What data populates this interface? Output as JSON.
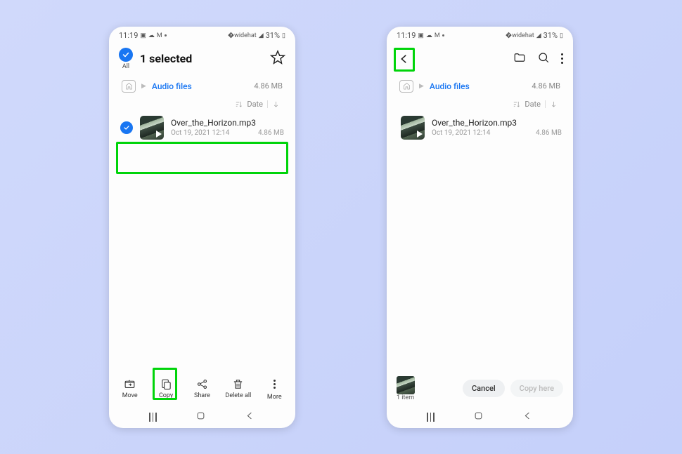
{
  "status": {
    "time": "11:19",
    "battery": "31%"
  },
  "left": {
    "all_label": "All",
    "title": "1 selected",
    "breadcrumb": {
      "label": "Audio files",
      "size": "4.86 MB"
    },
    "sort": {
      "label": "Date"
    },
    "file": {
      "name": "Over_the_Horizon.mp3",
      "date": "Oct 19, 2021 12:14",
      "size": "4.86 MB"
    },
    "actions": {
      "move": "Move",
      "copy": "Copy",
      "share": "Share",
      "delete": "Delete all",
      "more": "More"
    }
  },
  "right": {
    "breadcrumb": {
      "label": "Audio files",
      "size": "4.86 MB"
    },
    "sort": {
      "label": "Date"
    },
    "file": {
      "name": "Over_the_Horizon.mp3",
      "date": "Oct 19, 2021 12:14",
      "size": "4.86 MB"
    },
    "paste": {
      "count": "1 item",
      "cancel": "Cancel",
      "copy": "Copy here"
    }
  }
}
